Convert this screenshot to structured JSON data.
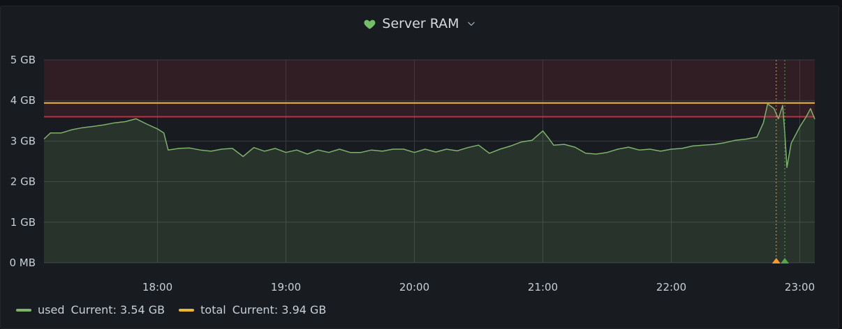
{
  "panel": {
    "title": "Server RAM",
    "status_icon": "heart-icon",
    "menu_icon": "chevron-down-icon",
    "status_color": "#73bf69"
  },
  "chart_data": {
    "type": "line",
    "xlabel": "",
    "ylabel": "",
    "x_ticks": [
      "18:00",
      "19:00",
      "20:00",
      "21:00",
      "22:00",
      "23:00"
    ],
    "x_range": [
      "17:07",
      "23:07"
    ],
    "y_ticks": [
      "0 MB",
      "1 GB",
      "2 GB",
      "3 GB",
      "4 GB",
      "5 GB"
    ],
    "ylim": [
      0,
      5
    ],
    "y_unit": "GB",
    "grid": true,
    "thresholds": [
      {
        "value": 3.6,
        "color": "#e02f44",
        "fill": "above"
      }
    ],
    "annotations": [
      {
        "time": "22:49",
        "color": "#ff9830"
      },
      {
        "time": "22:53",
        "color": "#56a64b"
      }
    ],
    "series": [
      {
        "name": "used",
        "color": "#7eb26d",
        "legend_text": "Current: 3.54 GB",
        "points": [
          [
            "17:07",
            3.05
          ],
          [
            "17:10",
            3.2
          ],
          [
            "17:15",
            3.2
          ],
          [
            "17:20",
            3.28
          ],
          [
            "17:25",
            3.33
          ],
          [
            "17:30",
            3.36
          ],
          [
            "17:35",
            3.4
          ],
          [
            "17:40",
            3.45
          ],
          [
            "17:45",
            3.48
          ],
          [
            "17:50",
            3.55
          ],
          [
            "17:55",
            3.42
          ],
          [
            "18:00",
            3.3
          ],
          [
            "18:03",
            3.2
          ],
          [
            "18:05",
            2.78
          ],
          [
            "18:10",
            2.82
          ],
          [
            "18:15",
            2.83
          ],
          [
            "18:20",
            2.78
          ],
          [
            "18:25",
            2.75
          ],
          [
            "18:30",
            2.8
          ],
          [
            "18:35",
            2.82
          ],
          [
            "18:40",
            2.62
          ],
          [
            "18:45",
            2.84
          ],
          [
            "18:50",
            2.75
          ],
          [
            "18:55",
            2.82
          ],
          [
            "19:00",
            2.72
          ],
          [
            "19:05",
            2.78
          ],
          [
            "19:10",
            2.68
          ],
          [
            "19:15",
            2.78
          ],
          [
            "19:20",
            2.72
          ],
          [
            "19:25",
            2.8
          ],
          [
            "19:30",
            2.72
          ],
          [
            "19:35",
            2.72
          ],
          [
            "19:40",
            2.78
          ],
          [
            "19:45",
            2.75
          ],
          [
            "19:50",
            2.8
          ],
          [
            "19:55",
            2.8
          ],
          [
            "20:00",
            2.72
          ],
          [
            "20:05",
            2.8
          ],
          [
            "20:10",
            2.73
          ],
          [
            "20:15",
            2.8
          ],
          [
            "20:20",
            2.76
          ],
          [
            "20:25",
            2.84
          ],
          [
            "20:30",
            2.9
          ],
          [
            "20:35",
            2.7
          ],
          [
            "20:40",
            2.8
          ],
          [
            "20:45",
            2.88
          ],
          [
            "20:50",
            2.98
          ],
          [
            "20:55",
            3.02
          ],
          [
            "21:00",
            3.25
          ],
          [
            "21:03",
            3.05
          ],
          [
            "21:05",
            2.9
          ],
          [
            "21:10",
            2.92
          ],
          [
            "21:15",
            2.85
          ],
          [
            "21:20",
            2.7
          ],
          [
            "21:25",
            2.68
          ],
          [
            "21:30",
            2.72
          ],
          [
            "21:35",
            2.8
          ],
          [
            "21:40",
            2.85
          ],
          [
            "21:45",
            2.78
          ],
          [
            "21:50",
            2.8
          ],
          [
            "21:55",
            2.75
          ],
          [
            "22:00",
            2.8
          ],
          [
            "22:05",
            2.82
          ],
          [
            "22:10",
            2.88
          ],
          [
            "22:15",
            2.9
          ],
          [
            "22:20",
            2.92
          ],
          [
            "22:25",
            2.96
          ],
          [
            "22:30",
            3.02
          ],
          [
            "22:35",
            3.05
          ],
          [
            "22:40",
            3.1
          ],
          [
            "22:43",
            3.45
          ],
          [
            "22:45",
            3.92
          ],
          [
            "22:48",
            3.8
          ],
          [
            "22:50",
            3.55
          ],
          [
            "22:52",
            3.88
          ],
          [
            "22:53",
            3.2
          ],
          [
            "22:54",
            2.35
          ],
          [
            "22:56",
            2.95
          ],
          [
            "23:00",
            3.35
          ],
          [
            "23:03",
            3.6
          ],
          [
            "23:05",
            3.8
          ],
          [
            "23:07",
            3.54
          ]
        ]
      },
      {
        "name": "total",
        "color": "#eab839",
        "legend_text": "Current: 3.94 GB",
        "points": [
          [
            "17:07",
            3.94
          ],
          [
            "23:07",
            3.94
          ]
        ]
      }
    ]
  }
}
